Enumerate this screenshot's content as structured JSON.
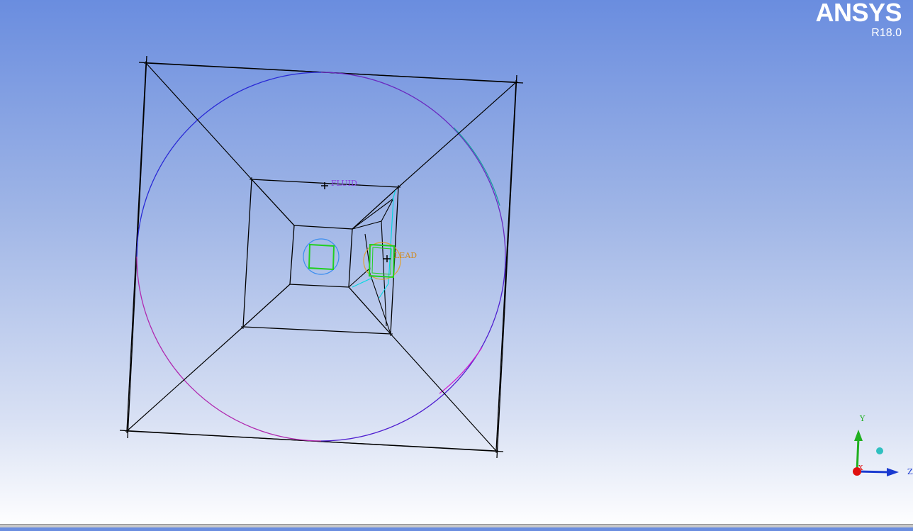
{
  "brand": {
    "name": "ANSYS",
    "version": "R18.0"
  },
  "labels": {
    "fluid": "FLUID",
    "lead": "LEAD"
  },
  "triad": {
    "y": "Y",
    "z": "Z",
    "x": "X"
  },
  "colors": {
    "edge": "#000000",
    "circle_primary": "#2a2ad6",
    "circle_accent": "#c020c0",
    "inner_circle": "#3a8ef0",
    "lead_circle": "#e0a030",
    "inner_block": "#20d020",
    "lead_block_edge": "#00d8e0",
    "fluid_label": "#8a40e0",
    "lead_label": "#d08a20",
    "axis_y": "#20b020",
    "axis_z": "#1a3ad0",
    "axis_x": "#e01010"
  }
}
